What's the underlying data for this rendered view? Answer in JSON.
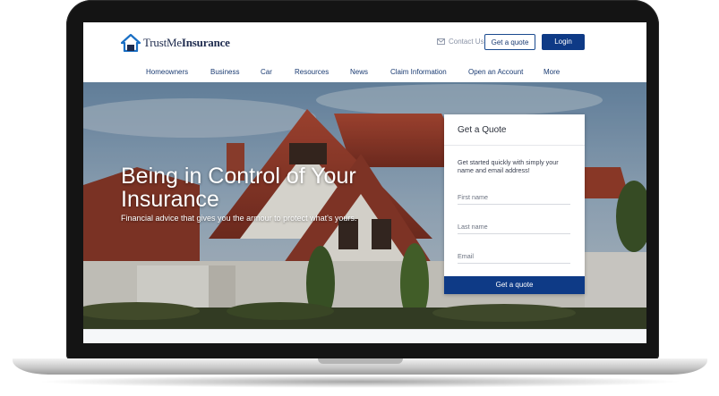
{
  "brand": {
    "name_light": "TrustMe",
    "name_bold": "Insurance"
  },
  "header": {
    "contact_label": "Contact Us",
    "quote_label": "Get a quote",
    "login_label": "Login"
  },
  "nav": {
    "items": [
      "Homeowners",
      "Business",
      "Car",
      "Resources",
      "News",
      "Claim Information",
      "Open an Account",
      "More"
    ]
  },
  "hero": {
    "title": "Being in Control of Your Insurance",
    "subtitle": "Financial advice that gives you the armour to protect what's yours."
  },
  "quote_card": {
    "title": "Get a Quote",
    "intro": "Get started quickly with simply your name and email address!",
    "first_name_placeholder": "First name",
    "last_name_placeholder": "Last name",
    "email_placeholder": "Email",
    "submit_label": "Get a quote"
  },
  "colors": {
    "primary": "#0e3a86",
    "nav_text": "#1a3b72",
    "frame": "#141414"
  },
  "icons": {
    "contact": "envelope-icon",
    "logo": "house-logo-icon"
  }
}
